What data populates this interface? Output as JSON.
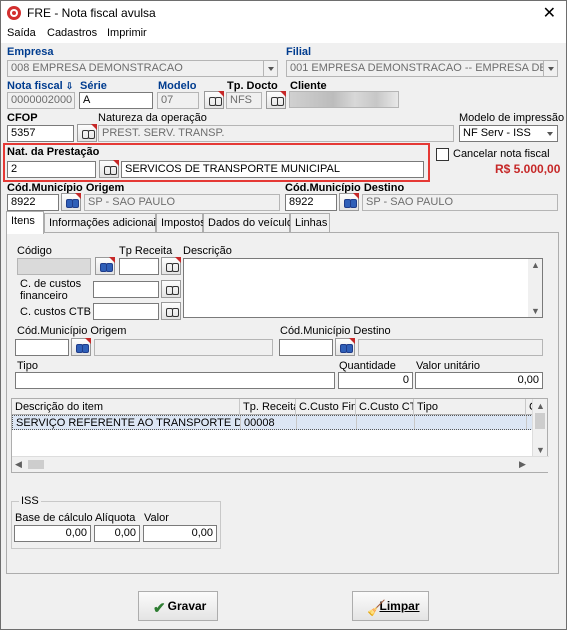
{
  "window": {
    "title": "FRE - Nota fiscal avulsa",
    "close": "✕"
  },
  "menu": [
    "Saída",
    "Cadastros",
    "Imprimir"
  ],
  "header": {
    "empresa_label": "Empresa",
    "empresa_value": "008 EMPRESA DEMONSTRACAO",
    "filial_label": "Filial",
    "filial_value": "001 EMPRESA DEMONSTRACAO -- EMPRESA DEMONS",
    "nota_label": "Nota fiscal",
    "nota_value": "0000002000",
    "serie_label": "Série",
    "serie_value": "A",
    "modelo_label": "Modelo",
    "modelo_value": "07",
    "tpdocto_label": "Tp. Docto",
    "tpdocto_value": "NFS",
    "cliente_label": "Cliente",
    "cfop_label": "CFOP",
    "cfop_value": "5357",
    "natureza_label": "Natureza da operação",
    "natureza_value": "PREST. SERV. TRANSP.",
    "modelo_impressao_label": "Modelo de impressão",
    "modelo_impressao_value": "NF Serv - ISS",
    "nat_prestacao_label": "Nat. da Prestação",
    "nat_prestacao_code": "2",
    "nat_prestacao_desc": "SERVICOS DE TRANSPORTE MUNICIPAL",
    "cancelar_label": "Cancelar nota fiscal",
    "total": "R$ 5.000,00",
    "mun_origem_label": "Cód.Município Origem",
    "mun_origem_code": "8922",
    "mun_origem_name": "SP - SAO PAULO",
    "mun_destino_label": "Cód.Município Destino",
    "mun_destino_code": "8922",
    "mun_destino_name": "SP - SAO PAULO"
  },
  "tabs": [
    "Itens",
    "Informações adicionais",
    "Impostos",
    "Dados do veículo",
    "Linhas"
  ],
  "itens": {
    "codigo_label": "Código",
    "tp_receita_label": "Tp Receita",
    "descricao_label": "Descrição",
    "cc_fin_label": "C. de custos financeiro",
    "cc_ctb_label": "C. custos CTB",
    "mun_origem_label": "Cód.Município Origem",
    "mun_destino_label": "Cód.Município Destino",
    "tipo_label": "Tipo",
    "quantidade_label": "Quantidade",
    "quantidade_value": "0",
    "valor_unit_label": "Valor unitário",
    "valor_unit_value": "0,00"
  },
  "grid": {
    "columns": [
      "Descrição do item",
      "Tp. Receita",
      "C.Custo Fin.",
      "C.Custo CTB",
      "Tipo",
      "C"
    ],
    "rows": [
      [
        "SERVIÇO REFERENTE AO TRANSPORTE DE P...",
        "00008",
        "",
        "",
        "",
        ""
      ]
    ]
  },
  "iss": {
    "title": "ISS",
    "base_label": "Base de cálculo",
    "base_value": "0,00",
    "aliquota_label": "Alíquota",
    "aliquota_value": "0,00",
    "valor_label": "Valor",
    "valor_value": "0,00"
  },
  "buttons": {
    "gravar": "Gravar",
    "limpar": "Limpar"
  },
  "colors": {
    "required_label": "#003c8f",
    "total": "#c62828",
    "highlight_box": "#e53935"
  }
}
